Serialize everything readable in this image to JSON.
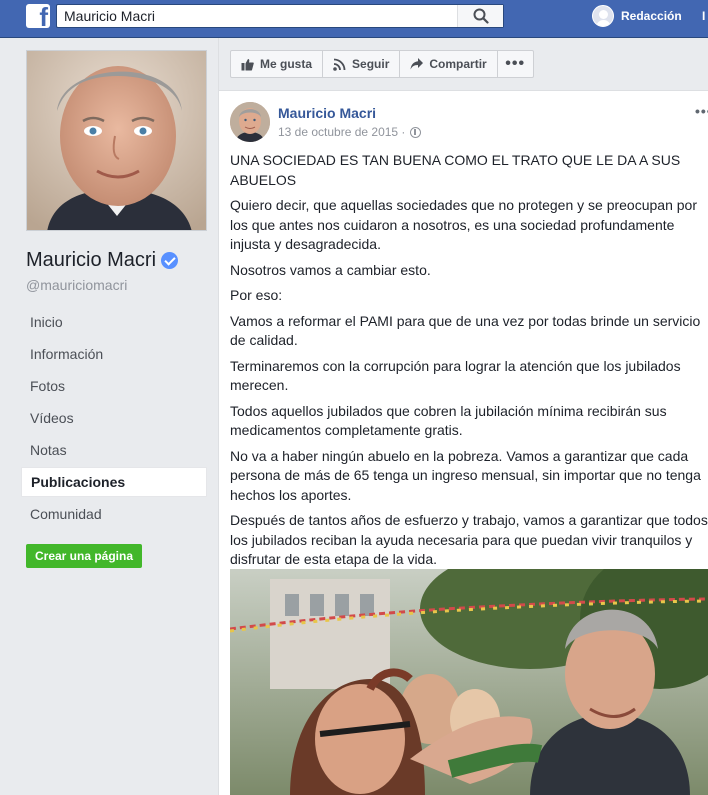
{
  "topbar": {
    "logo": "f",
    "search_value": "Mauricio Macri",
    "search_icon": "search-icon",
    "user_name": "Redacción",
    "cut_text": "I"
  },
  "sidebar": {
    "page_name": "Mauricio Macri",
    "handle": "@mauriciomacri",
    "nav": [
      "Inicio",
      "Información",
      "Fotos",
      "Vídeos",
      "Notas",
      "Publicaciones",
      "Comunidad"
    ],
    "active_index": 5,
    "create_page_label": "Crear una página"
  },
  "actions": {
    "like": "Me gusta",
    "follow": "Seguir",
    "share": "Compartir",
    "more": "•••"
  },
  "post": {
    "author": "Mauricio Macri",
    "date": "13 de octubre de 2015 ·",
    "menu": "•••",
    "paragraphs": [
      "UNA SOCIEDAD ES TAN BUENA COMO EL TRATO QUE LE DA A SUS ABUELOS",
      "Quiero decir, que aquellas sociedades que no protegen y se preocupan por los que antes nos cuidaron a nosotros, es una sociedad profundamente injusta y desagradecida.",
      "Nosotros vamos a cambiar esto.",
      "Por eso:",
      "Vamos a reformar el PAMI para que de una vez por todas brinde un servicio de calidad.",
      "Terminaremos con la corrupción para lograr la atención que los jubilados merecen.",
      "Todos aquellos jubilados que cobren la jubilación mínima recibirán sus medicamentos completamente gratis.",
      "No va a haber ningún abuelo en la pobreza. Vamos a garantizar que cada persona de más de 65 tenga un ingreso mensual, sin importar que no tenga hechos los aportes.",
      "Después de tantos años de esfuerzo y trabajo, vamos a garantizar que todos los jubilados reciban la ayuda necesaria para que puedan vivir tranquilos y disfrutar de esta etapa de la vida."
    ]
  },
  "colors": {
    "brand": "#4267b2",
    "link": "#365899",
    "green": "#42b72a"
  }
}
